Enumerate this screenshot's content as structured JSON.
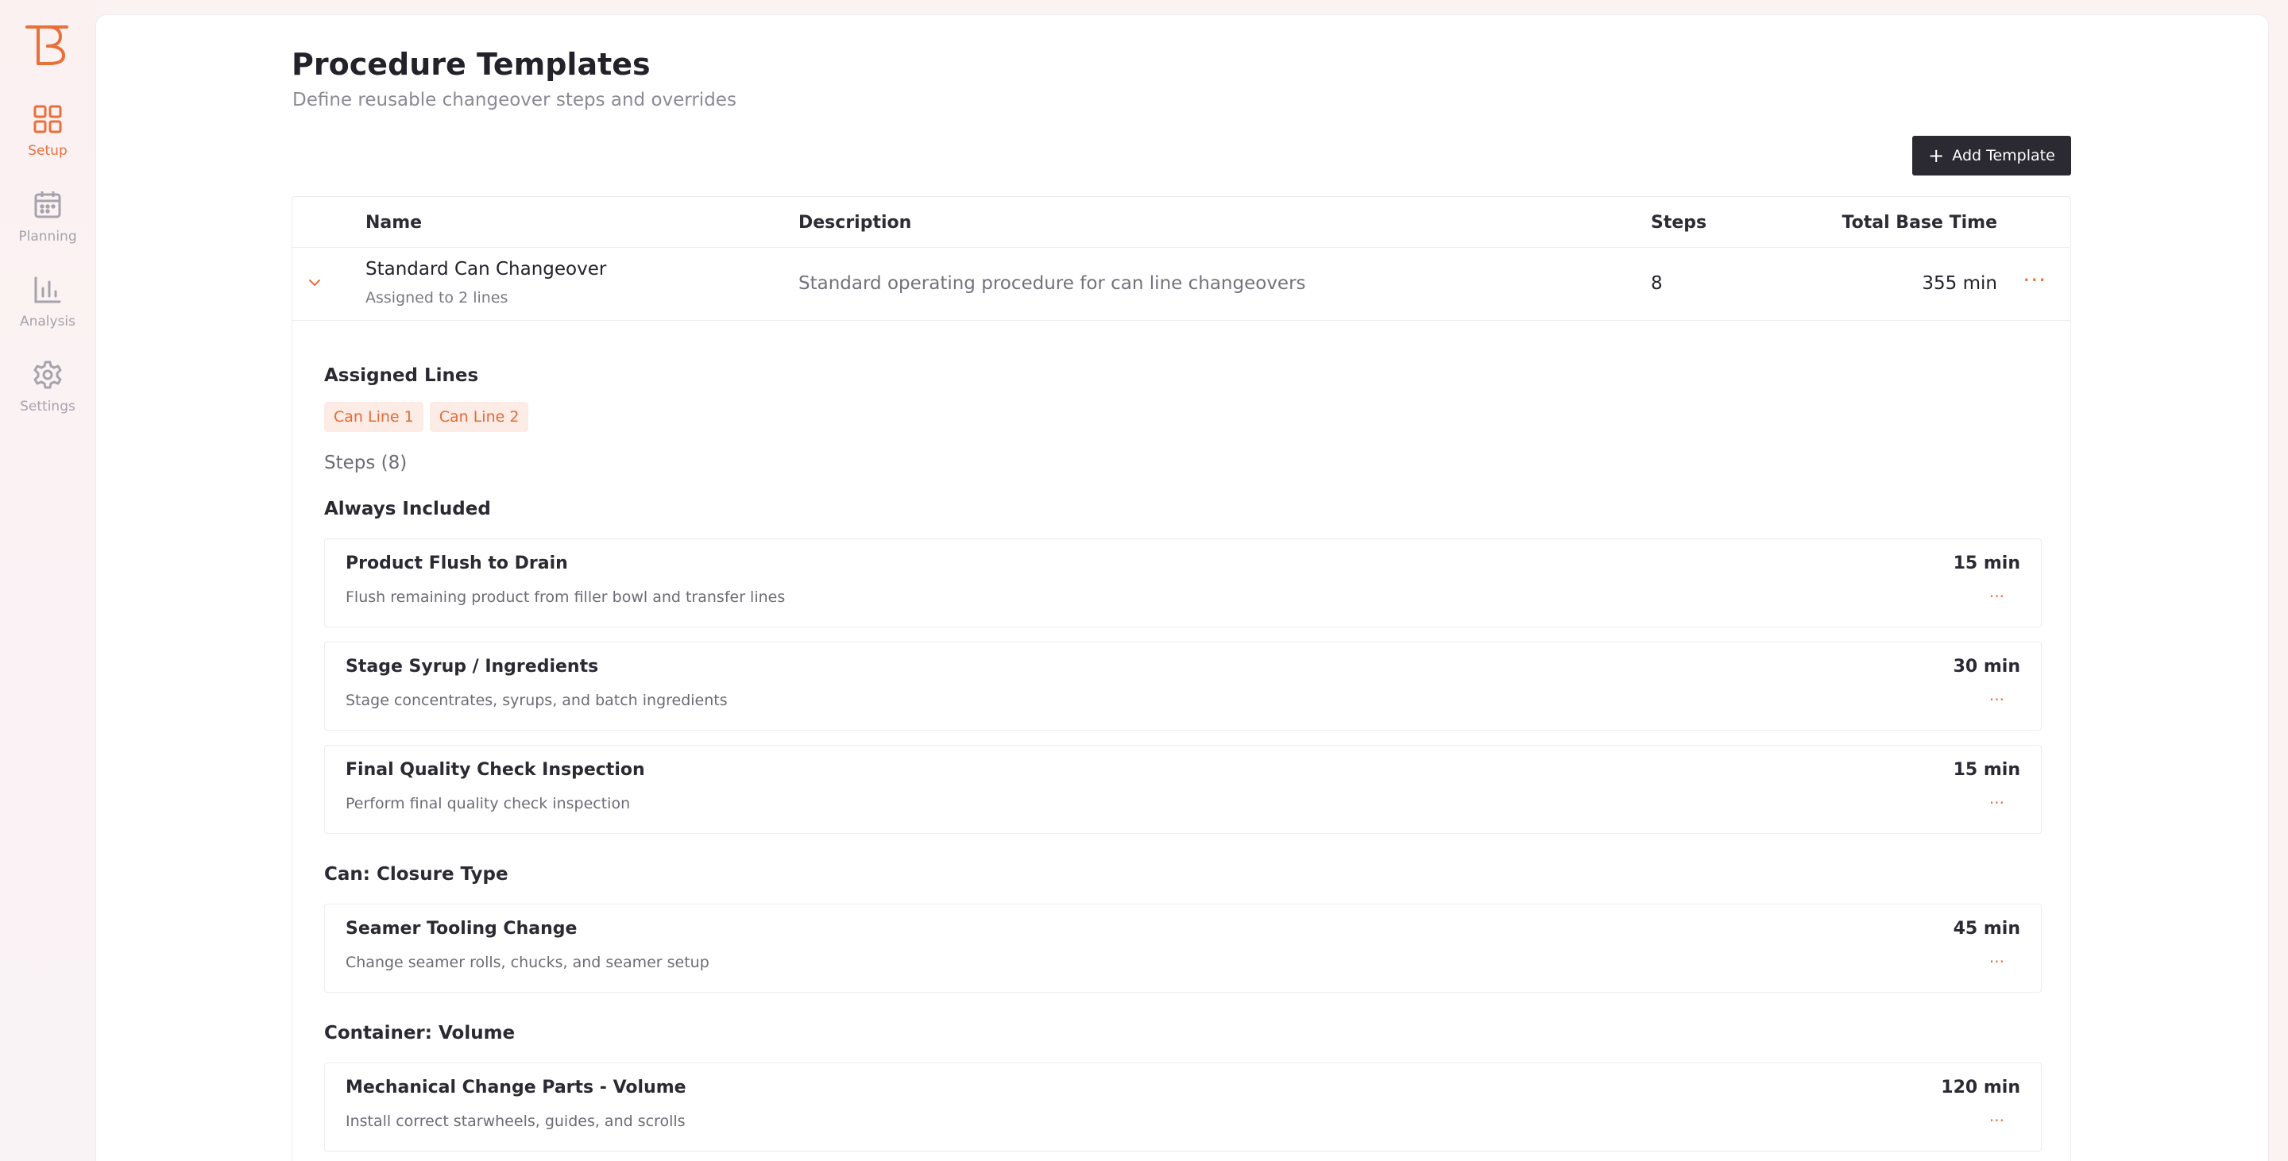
{
  "sidebar": {
    "logo": "logo-icon",
    "items": [
      {
        "label": "Setup",
        "icon": "grid-icon",
        "active": true
      },
      {
        "label": "Planning",
        "icon": "calendar-icon",
        "active": false
      },
      {
        "label": "Analysis",
        "icon": "bar-chart-icon",
        "active": false
      },
      {
        "label": "Settings",
        "icon": "gear-icon",
        "active": false
      }
    ]
  },
  "header": {
    "title": "Procedure Templates",
    "subtitle": "Define reusable changeover steps and overrides",
    "add_button_label": "Add Template"
  },
  "table": {
    "columns": {
      "name": "Name",
      "description": "Description",
      "steps": "Steps",
      "total_base_time": "Total Base Time"
    },
    "rows": [
      {
        "name": "Standard Can Changeover",
        "assigned": "Assigned to 2 lines",
        "description": "Standard operating procedure for can line changeovers",
        "steps": "8",
        "total_base_time": "355 min",
        "more": "···"
      }
    ]
  },
  "expanded": {
    "assigned_lines_title": "Assigned Lines",
    "assigned_lines": [
      "Can Line 1",
      "Can Line 2"
    ],
    "steps_label": "Steps (8)",
    "groups": [
      {
        "title": "Always Included",
        "steps": [
          {
            "name": "Product Flush to Drain",
            "description": "Flush remaining product from filler bowl and transfer lines",
            "time": "15 min"
          },
          {
            "name": "Stage Syrup / Ingredients",
            "description": "Stage concentrates, syrups, and batch ingredients",
            "time": "30 min"
          },
          {
            "name": "Final Quality Check Inspection",
            "description": "Perform final quality check inspection",
            "time": "15 min"
          }
        ]
      },
      {
        "title": "Can: Closure Type",
        "steps": [
          {
            "name": "Seamer Tooling Change",
            "description": "Change seamer rolls, chucks, and seamer setup",
            "time": "45 min"
          }
        ]
      },
      {
        "title": "Container: Volume",
        "steps": [
          {
            "name": "Mechanical Change Parts - Volume",
            "description": "Install correct starwheels, guides, and scrolls",
            "time": "120 min"
          }
        ]
      }
    ],
    "step_more": "···"
  },
  "colors": {
    "accent": "#e8703b",
    "dark": "#2b2a33",
    "tag_bg": "#fdece6"
  }
}
